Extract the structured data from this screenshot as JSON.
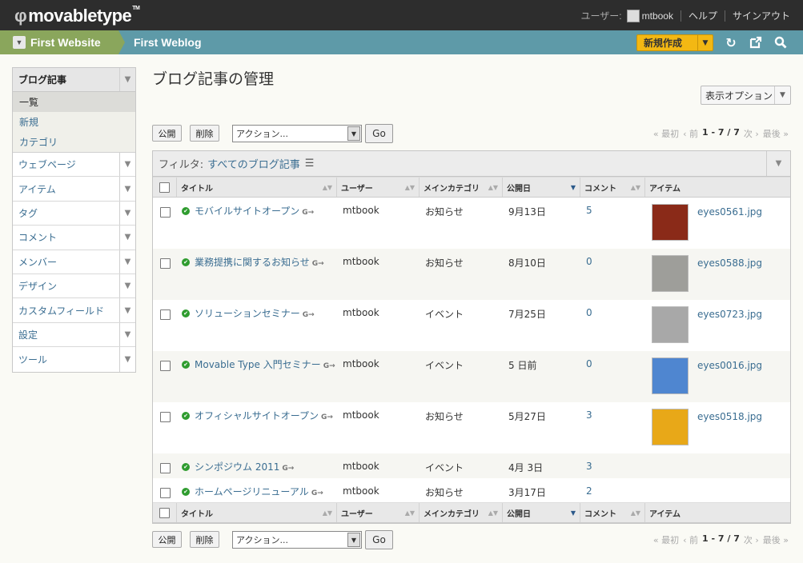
{
  "header": {
    "logo_text": "movabletype",
    "logo_tm": "TM",
    "user_label": "ユーザー:",
    "username": "mtbook",
    "help": "ヘルプ",
    "signout": "サインアウト"
  },
  "nav": {
    "website": "First Website",
    "blog": "First Weblog",
    "new_label": "新規作成"
  },
  "sidebar": {
    "active_section": "ブログ記事",
    "sub_items": [
      {
        "label": "一覧",
        "active": true
      },
      {
        "label": "新規",
        "active": false
      },
      {
        "label": "カテゴリ",
        "active": false
      }
    ],
    "items": [
      "ウェブページ",
      "アイテム",
      "タグ",
      "コメント",
      "メンバー",
      "デザイン",
      "カスタムフィールド",
      "設定",
      "ツール"
    ]
  },
  "main": {
    "title": "ブログ記事の管理",
    "view_options": "表示オプション",
    "publish_btn": "公開",
    "delete_btn": "削除",
    "action_select": "アクション...",
    "go_btn": "Go",
    "pager": {
      "first": "« 最初",
      "prev": "‹ 前",
      "range": "1 - 7 / 7",
      "next": "次 ›",
      "last": "最後 »"
    },
    "filter_label": "フィルタ:",
    "filter_value": "すべてのブログ記事",
    "columns": [
      "タイトル",
      "ユーザー",
      "メインカテゴリ",
      "公開日",
      "コメント",
      "アイテム"
    ],
    "rows": [
      {
        "title": "モバイルサイトオープン",
        "user": "mtbook",
        "category": "お知らせ",
        "date": "9月13日",
        "comments": "5",
        "item": "eyes0561.jpg",
        "thumb_color": "#8a2a18"
      },
      {
        "title": "業務提携に関するお知らせ",
        "user": "mtbook",
        "category": "お知らせ",
        "date": "8月10日",
        "comments": "0",
        "item": "eyes0588.jpg",
        "thumb_color": "#9e9e9a"
      },
      {
        "title": "ソリューションセミナー",
        "user": "mtbook",
        "category": "イベント",
        "date": "7月25日",
        "comments": "0",
        "item": "eyes0723.jpg",
        "thumb_color": "#a8a8a8"
      },
      {
        "title": "Movable Type 入門セミナー",
        "user": "mtbook",
        "category": "イベント",
        "date": "5 日前",
        "comments": "0",
        "item": "eyes0016.jpg",
        "thumb_color": "#4f86d0"
      },
      {
        "title": "オフィシャルサイトオープン",
        "user": "mtbook",
        "category": "お知らせ",
        "date": "5月27日",
        "comments": "3",
        "item": "eyes0518.jpg",
        "thumb_color": "#e8a818"
      },
      {
        "title": "シンポジウム 2011",
        "user": "mtbook",
        "category": "イベント",
        "date": "4月 3日",
        "comments": "3",
        "item": "",
        "thumb_color": ""
      },
      {
        "title": "ホームページリニューアル",
        "user": "mtbook",
        "category": "お知らせ",
        "date": "3月17日",
        "comments": "2",
        "item": "",
        "thumb_color": ""
      }
    ]
  }
}
